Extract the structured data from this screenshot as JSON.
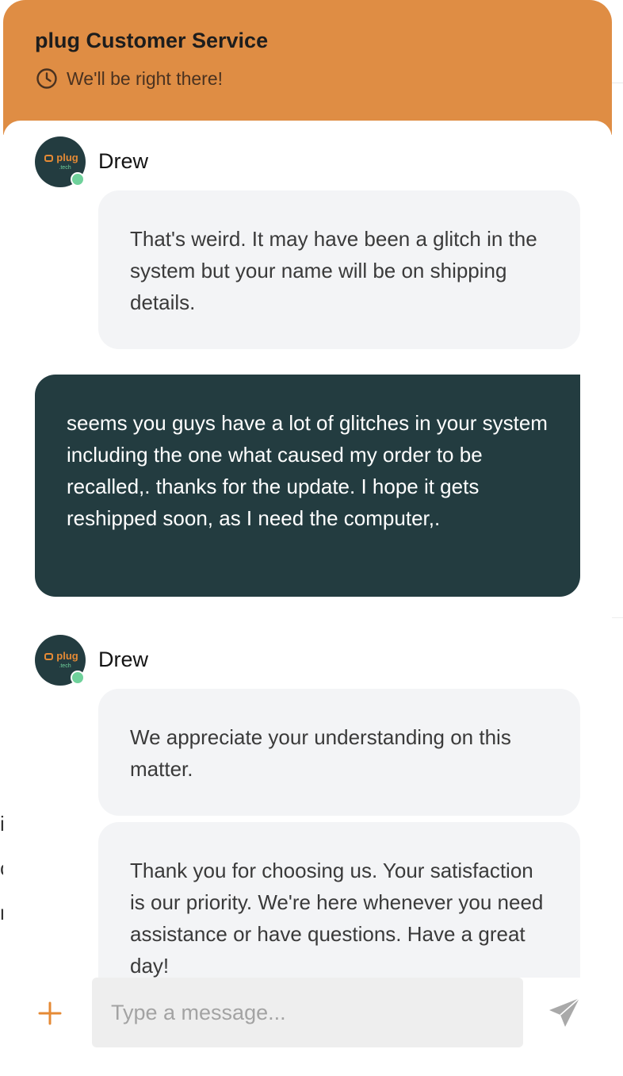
{
  "header": {
    "title": "plug Customer Service",
    "status": "We'll be right there!",
    "color": "#df8d44"
  },
  "messages": [
    {
      "sender": "agent",
      "name": "Drew",
      "text": "That's weird. It may have been a glitch in the system but your name will be on shipping details."
    },
    {
      "sender": "user",
      "text": "seems you guys have a lot of glitches in your system including the one what caused my order to be recalled,. thanks for the update. I hope it gets reshipped soon, as I need the computer,."
    },
    {
      "sender": "agent",
      "name": "Drew",
      "text": "We appreciate your understanding on this matter."
    },
    {
      "sender": "agent",
      "name": "Drew",
      "text": "Thank you for choosing us. Your satisfaction is our priority. We're here whenever you need assistance or have questions. Have a great day!"
    }
  ],
  "avatar": {
    "logo_text": "plug",
    "logo_subtext": ".tech",
    "status": "online",
    "status_color": "#6fd19b"
  },
  "composer": {
    "placeholder": "Type a message...",
    "attach_icon": "plus-icon",
    "send_icon": "send-icon"
  },
  "colors": {
    "accent": "#df8d44",
    "user_bubble": "#233c40",
    "agent_bubble": "#f3f4f6"
  }
}
